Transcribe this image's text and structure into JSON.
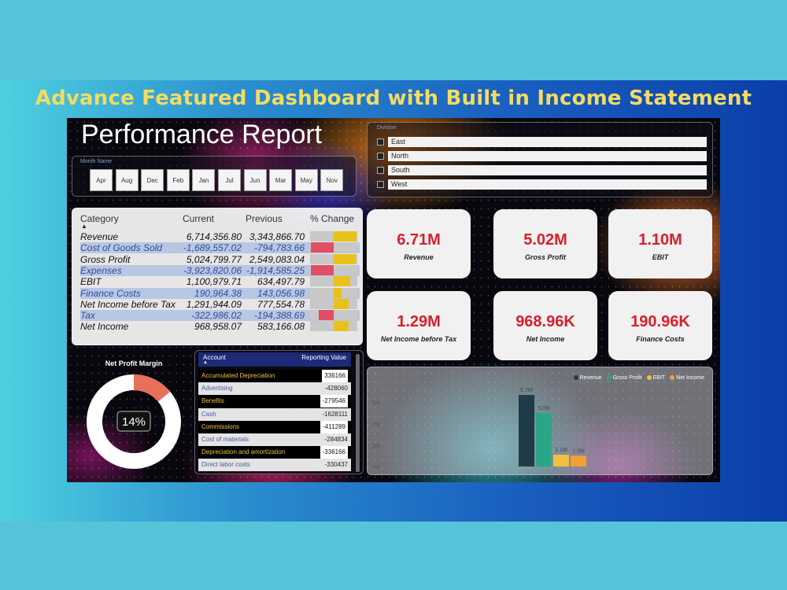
{
  "headline": "Advance Featured Dashboard with Built in Income Statement",
  "report_title": "Performance Report",
  "month_slicer": {
    "label": "Month Name",
    "months": [
      "Apr",
      "Aug",
      "Dec",
      "Feb",
      "Jan",
      "Jul",
      "Jun",
      "Mar",
      "May",
      "Nov"
    ]
  },
  "division_slicer": {
    "label": "Division",
    "regions": [
      "East",
      "North",
      "South",
      "West"
    ]
  },
  "income_table": {
    "headers": {
      "category": "Category",
      "current": "Current",
      "previous": "Previous",
      "change": "% Change"
    },
    "rows": [
      {
        "category": "Revenue",
        "current": "6,714,356.80",
        "previous": "3,343,866.70",
        "change_pct": 1.0
      },
      {
        "category": "Cost of Goods Sold",
        "current": "-1,689,557.02",
        "previous": "-794,783.66",
        "change_pct": -1.0
      },
      {
        "category": "Gross Profit",
        "current": "5,024,799.77",
        "previous": "2,549,083.04",
        "change_pct": 0.97
      },
      {
        "category": "Expenses",
        "current": "-3,923,820.06",
        "previous": "-1,914,585.25",
        "change_pct": -1.0
      },
      {
        "category": "EBIT",
        "current": "1,100,979.71",
        "previous": "634,497.79",
        "change_pct": 0.73
      },
      {
        "category": "Finance Costs",
        "current": "190,964.38",
        "previous": "143,056.98",
        "change_pct": 0.33
      },
      {
        "category": "Net Income before Tax",
        "current": "1,291,944.09",
        "previous": "777,554.78",
        "change_pct": 0.66
      },
      {
        "category": "Tax",
        "current": "-322,986.02",
        "previous": "-194,388.69",
        "change_pct": -0.66
      },
      {
        "category": "Net Income",
        "current": "968,958.07",
        "previous": "583,166.08",
        "change_pct": 0.66
      }
    ]
  },
  "kpis": [
    {
      "value": "6.71M",
      "label": "Revenue"
    },
    {
      "value": "5.02M",
      "label": "Gross Profit"
    },
    {
      "value": "1.10M",
      "label": "EBIT"
    },
    {
      "value": "1.29M",
      "label": "Net Income before Tax"
    },
    {
      "value": "968.96K",
      "label": "Net Income"
    },
    {
      "value": "190.96K",
      "label": "Finance Costs"
    }
  ],
  "net_profit_margin": {
    "title": "Net Profit Margin",
    "value_text": "14%",
    "value": 0.14
  },
  "account_table": {
    "headers": {
      "account": "Account",
      "value": "Reporting Value"
    },
    "rows": [
      {
        "account": "Accumulated Depreciation",
        "value": "336166"
      },
      {
        "account": "Advertising",
        "value": "-428060"
      },
      {
        "account": "Benefits",
        "value": "-279546"
      },
      {
        "account": "Cash",
        "value": "-1628111"
      },
      {
        "account": "Commissions",
        "value": "-411289"
      },
      {
        "account": "Cost of materials",
        "value": "-284834"
      },
      {
        "account": "Depreciation and amortization",
        "value": "-336166"
      },
      {
        "account": "Direct labor costs",
        "value": "-330437"
      }
    ]
  },
  "colors": {
    "red": "#d7202d",
    "gold": "#e8c21a",
    "bar_red": "#e05064"
  },
  "chart_data": {
    "type": "bar",
    "categories": [
      "Revenue",
      "Gross Profit",
      "EBIT",
      "Net Income"
    ],
    "values": [
      6.7,
      5.0,
      1.1,
      1.0
    ],
    "data_labels": [
      "6.7M",
      "5.0M",
      "1.1M",
      "1.0M"
    ],
    "colors": [
      "#1f3b4a",
      "#2aa585",
      "#f0c040",
      "#f4a030"
    ],
    "y_ticks": [
      "0M",
      "2M",
      "4M",
      "6M"
    ],
    "ylim": [
      0,
      7
    ],
    "legend": [
      "Revenue",
      "Gross Profit",
      "EBIT",
      "Net Income"
    ],
    "legend_position": "top-right"
  }
}
